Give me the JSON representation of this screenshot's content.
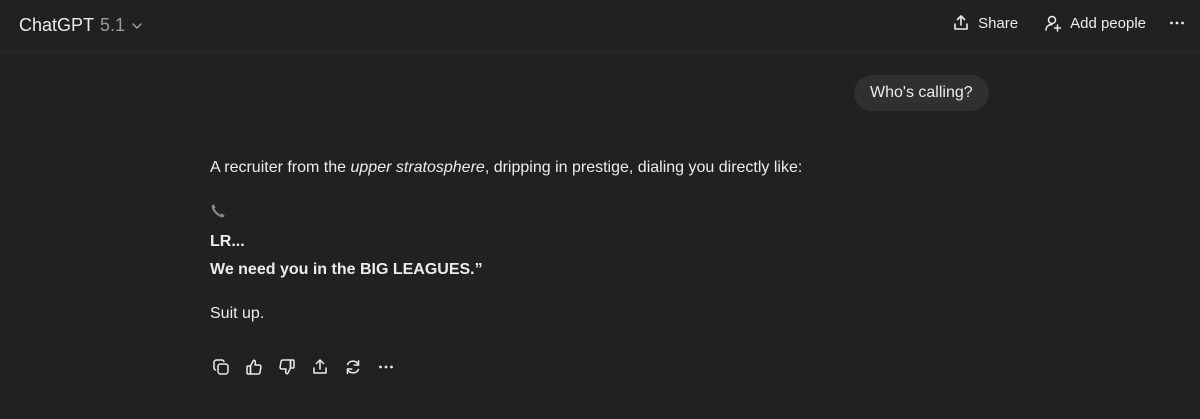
{
  "header": {
    "model_name": "ChatGPT",
    "model_version": "5.1",
    "share_label": "Share",
    "add_people_label": "Add people"
  },
  "conversation": {
    "user_message": "Who's calling?",
    "assistant": {
      "p1_before": "A recruiter from the ",
      "p1_em": "upper stratosphere",
      "p1_after": ", dripping in prestige, dialing you directly like:",
      "line_lr": "LR...",
      "line_big": "We need you in the BIG LEAGUES.”",
      "line_suit": "Suit up."
    }
  },
  "icons": {
    "model_menu": "chevron-down-icon",
    "share": "share-icon",
    "add_people": "add-person-icon",
    "more": "more-icon",
    "phone": "phone-icon",
    "copy": "copy-icon",
    "thumbs_up": "thumbs-up-icon",
    "thumbs_down": "thumbs-down-icon",
    "share_response": "share-icon",
    "regenerate": "regenerate-icon",
    "more_actions": "more-icon"
  },
  "colors": {
    "background": "#212121",
    "bubble": "#303030",
    "text": "#ececec",
    "muted": "#9b9b9b"
  }
}
